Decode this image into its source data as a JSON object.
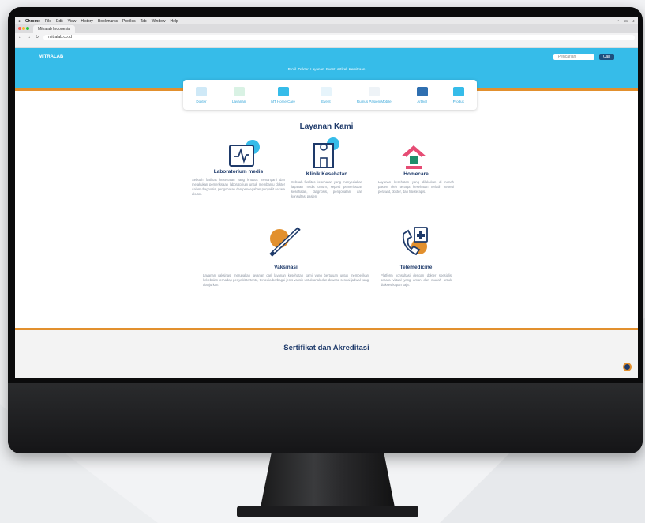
{
  "browser": {
    "app_name": "Chrome",
    "menu_items": [
      "File",
      "Edit",
      "View",
      "History",
      "Bookmarks",
      "Profiles",
      "Tab",
      "Window",
      "Help"
    ],
    "tab_title": "Mitralab Indonesia",
    "url": "mitralab.co.id"
  },
  "site": {
    "logo": "MITRALAB",
    "search_placeholder": "Pencarian",
    "search_button": "Cari",
    "subnav": [
      "Profil",
      "Dokter",
      "Layanan",
      "Event",
      "Artikel",
      "Kemitraan"
    ],
    "nav_items": [
      "Dokter",
      "Layanan",
      "MT Home Care",
      "Event",
      "Rumus Pasien/Mobile",
      "Artikel",
      "Produk"
    ]
  },
  "layanan": {
    "title": "Layanan Kami",
    "services": [
      {
        "name": "Laboratorium medis",
        "desc": "Sebuah fasilitas kesehatan yang khusus menangani dan melakukan pemeriksaan laboratorium untuk membantu dokter dalam diagnosis, pengobatan dan pencegahan penyakit secara akurat."
      },
      {
        "name": "Klinik Kesehatan",
        "desc": "Sebuah fasilitas kesehatan yang menyediakan layanan medis umum, seperti pemeriksaan kesehatan, diagnosis, pengobatan, dan konsultasi pasien."
      },
      {
        "name": "Homecare",
        "desc": "Layanan kesehatan yang dilakukan di rumah pasien oleh tenaga kesehatan terlatih seperti perawat, dokter, dan fisioterapis."
      },
      {
        "name": "Vaksinasi",
        "desc": "Layanan vaksinasi merupakan layanan dari layanan kesehatan kami yang bertujuan untuk memberikan kekebalan terhadap penyakit tertentu, tersedia berbagai jenis vaksin untuk anak dan dewasa sesuai jadwal yang dianjurkan."
      },
      {
        "name": "Telemedicine",
        "desc": "Platform konsultasi dengan dokter spesialis secara virtual yang aman dan mudah untuk diakses kapan saja."
      }
    ]
  },
  "sertifikat": {
    "title": "Sertifikat dan Akreditasi"
  },
  "colors": {
    "primary": "#36bce9",
    "accent": "#e2902e",
    "navy": "#1e3a6a"
  }
}
